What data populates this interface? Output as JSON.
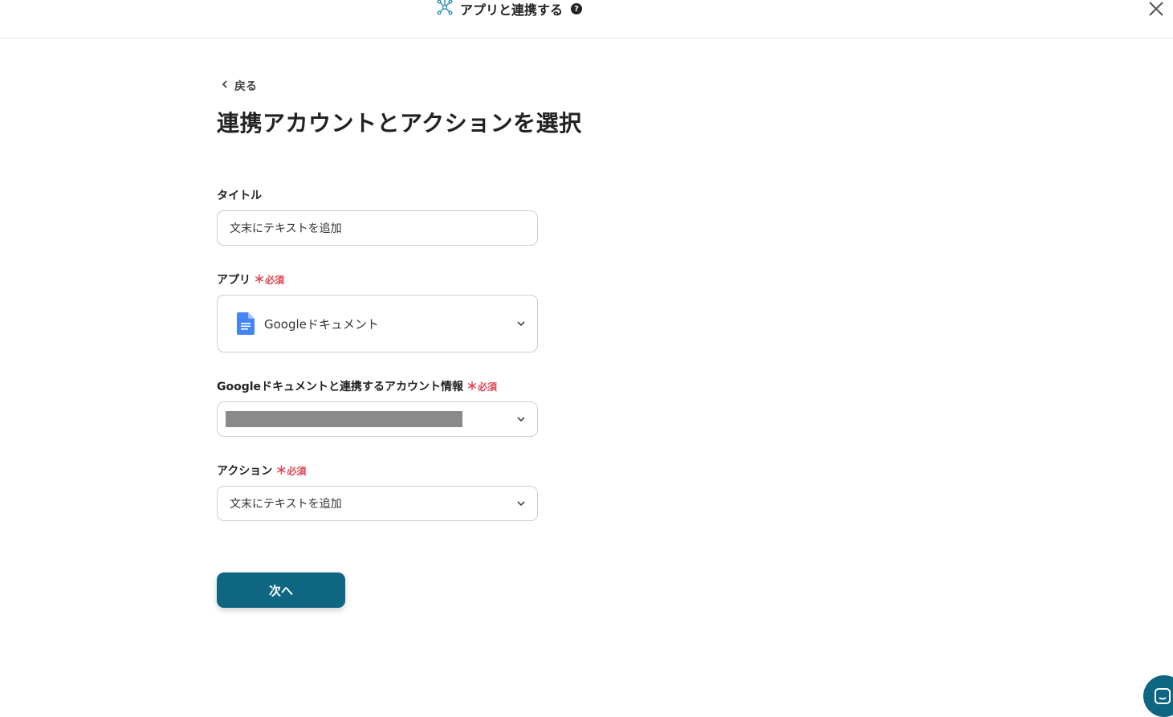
{
  "header": {
    "title": "アプリと連携する",
    "help_symbol": "?",
    "connect_icon": "network-nodes-icon",
    "close_icon": "close-icon"
  },
  "back": {
    "label": "戻る",
    "icon": "chevron-left-icon"
  },
  "page_title": "連携アカウントとアクションを選択",
  "form": {
    "title_field": {
      "label": "タイトル",
      "value": "文末にテキストを追加"
    },
    "app_field": {
      "label": "アプリ",
      "required_mark": "＊",
      "required_text": "必須",
      "value": "Googleドキュメント",
      "icon": "google-docs-icon"
    },
    "account_field": {
      "label": "Googleドキュメントと連携するアカウント情報",
      "required_mark": "＊",
      "required_text": "必須"
    },
    "action_field": {
      "label": "アクション",
      "required_mark": "＊",
      "required_text": "必須",
      "value": "文末にテキストを追加"
    }
  },
  "next_button": {
    "label": "次へ"
  },
  "colors": {
    "accent": "#0f6683",
    "required": "#e2434f",
    "google_docs_blue": "#4285f4",
    "connect_icon": "#2a8fb0"
  }
}
